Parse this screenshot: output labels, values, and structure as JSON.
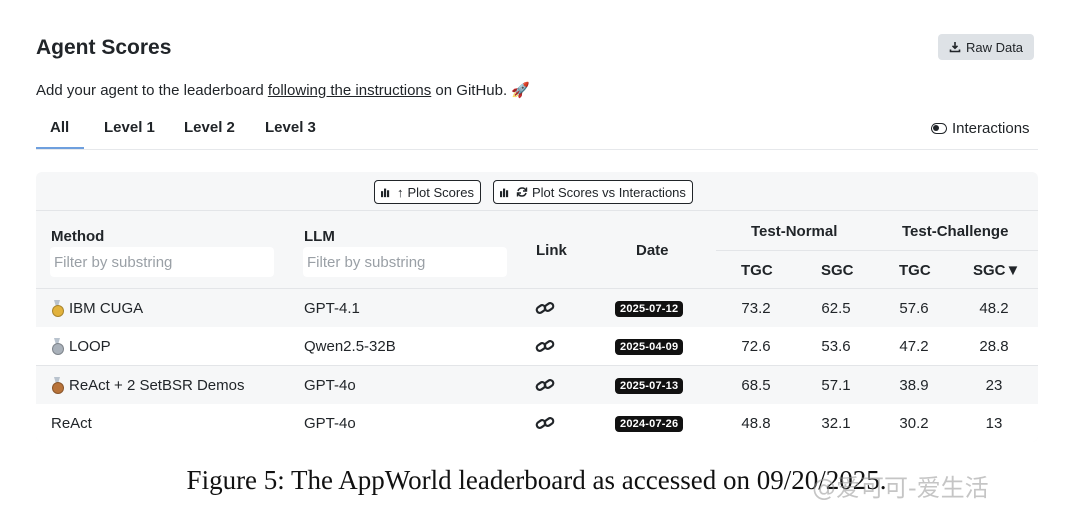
{
  "header": {
    "title": "Agent Scores",
    "raw_data_label": "Raw Data",
    "intro_prefix": "Add your agent to the leaderboard ",
    "intro_link": "following the instructions",
    "intro_suffix": " on GitHub. 🚀"
  },
  "tabs": [
    "All",
    "Level 1",
    "Level 2",
    "Level 3"
  ],
  "active_tab": "All",
  "interactions_label": "Interactions",
  "toolbar": {
    "plot_scores_label": "Plot Scores",
    "plot_vs_interactions_label": "Plot Scores vs Interactions"
  },
  "table": {
    "headers": {
      "method": "Method",
      "llm": "LLM",
      "link": "Link",
      "date": "Date",
      "test_normal": "Test-Normal",
      "test_challenge": "Test-Challenge",
      "tgc": "TGC",
      "sgc": "SGC",
      "sgc_sorted": "SGC▼"
    },
    "filter_placeholder": "Filter by substring",
    "rows": [
      {
        "medal": "gold",
        "method": "IBM CUGA",
        "llm": "GPT-4.1",
        "date": "2025-07-12",
        "n_tgc": "73.2",
        "n_sgc": "62.5",
        "c_tgc": "57.6",
        "c_sgc": "48.2"
      },
      {
        "medal": "silver",
        "method": "LOOP",
        "llm": "Qwen2.5-32B",
        "date": "2025-04-09",
        "n_tgc": "72.6",
        "n_sgc": "53.6",
        "c_tgc": "47.2",
        "c_sgc": "28.8"
      },
      {
        "medal": "bronze",
        "method": "ReAct + 2 SetBSR Demos",
        "llm": "GPT-4o",
        "date": "2025-07-13",
        "n_tgc": "68.5",
        "n_sgc": "57.1",
        "c_tgc": "38.9",
        "c_sgc": "23"
      },
      {
        "medal": "",
        "method": "ReAct",
        "llm": "GPT-4o",
        "date": "2024-07-26",
        "n_tgc": "48.8",
        "n_sgc": "32.1",
        "c_tgc": "30.2",
        "c_sgc": "13"
      }
    ]
  },
  "colors": {
    "gold": "#e2b23c",
    "silver": "#a9b1ba",
    "bronze": "#b8733a",
    "tab_underline": "#6e9fde"
  },
  "caption": "Figure 5: The AppWorld leaderboard as accessed on 09/20/2025.",
  "watermark": "@爱可可-爱生活"
}
